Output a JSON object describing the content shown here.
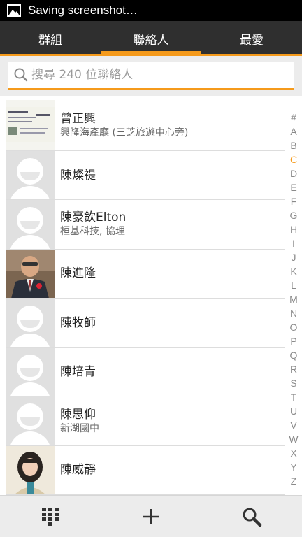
{
  "status_bar": {
    "notification": "Saving screenshot…"
  },
  "tabs": [
    {
      "label": "群組",
      "active": false
    },
    {
      "label": "聯絡人",
      "active": true
    },
    {
      "label": "最愛",
      "active": false
    }
  ],
  "search": {
    "placeholder": "搜尋 240 位聯絡人"
  },
  "contacts": [
    {
      "name": "曾正興",
      "subtitle": "興隆海產廳 (三芝旅遊中心旁)",
      "avatar": "business-card-photo"
    },
    {
      "name": "陳燦禔",
      "subtitle": "",
      "avatar": "default-person-icon"
    },
    {
      "name": "陳豪欽Elton",
      "subtitle": "桓基科技, 協理",
      "avatar": "default-person-icon"
    },
    {
      "name": "陳進隆",
      "subtitle": "",
      "avatar": "man-in-suit-photo"
    },
    {
      "name": "陳牧師",
      "subtitle": "",
      "avatar": "default-person-icon"
    },
    {
      "name": "陳培青",
      "subtitle": "",
      "avatar": "default-person-icon"
    },
    {
      "name": "陳思仰",
      "subtitle": "新湖國中",
      "avatar": "default-person-icon"
    },
    {
      "name": "陳威靜",
      "subtitle": "",
      "avatar": "woman-photo"
    }
  ],
  "index_letters": [
    "#",
    "A",
    "B",
    "C",
    "D",
    "E",
    "F",
    "G",
    "H",
    "I",
    "J",
    "K",
    "L",
    "M",
    "N",
    "O",
    "P",
    "Q",
    "R",
    "S",
    "T",
    "U",
    "V",
    "W",
    "X",
    "Y",
    "Z"
  ],
  "index_highlight": "C",
  "bottom_bar": [
    "dialpad-icon",
    "add-icon",
    "search-icon"
  ],
  "colors": {
    "accent": "#f59a1b",
    "tab_bar": "#2f2f2f",
    "avatar_bg": "#e0e0e0"
  }
}
